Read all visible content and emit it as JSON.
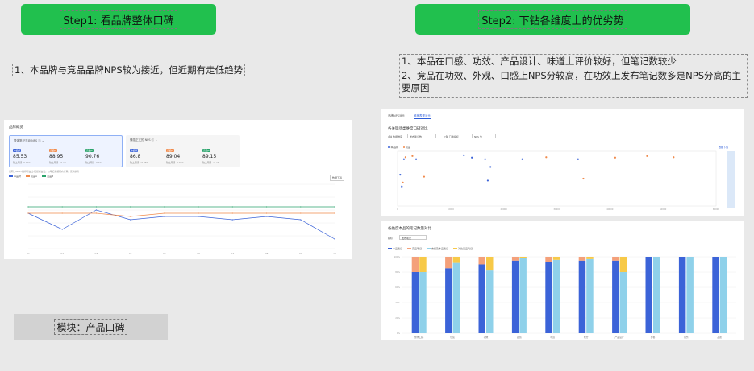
{
  "step1": {
    "label": "Step1: 看品牌整体口碑"
  },
  "step2": {
    "label": "Step2: 下钻各维度上的优劣势"
  },
  "note1": "1、本品牌与竞品品牌NPS较为接近，但近期有走低趋势",
  "note2": {
    "line1": "1、本品在口感、功效、产品设计、味道上评价较好，但笔记数较少",
    "line2": "2、竞品在功效、外观、口感上NPS分较高，在功效上发布笔记数多是NPS分高的主要原因"
  },
  "module": "模块：产品口碑",
  "left_panel": {
    "title": "品牌概览",
    "card1_title": "整体笔记互动 NPS ⓘ ⌄",
    "card2_title": "情感正文的 NPS ⓘ ⌄",
    "brands": [
      {
        "tag": "本品牌",
        "color": "#3b63d8",
        "value": "85.53",
        "sub": "较上周期 -0.01%"
      },
      {
        "tag": "竞品A",
        "color": "#f08a4b",
        "value": "88.95",
        "sub": "较上周期 +0.1%"
      },
      {
        "tag": "竞品B",
        "color": "#2aa36b",
        "value": "90.76",
        "sub": "较上周期 -0.1%"
      },
      {
        "tag": "本品牌",
        "color": "#3b63d8",
        "value": "86.8",
        "sub": "较上周期 +0.05%"
      },
      {
        "tag": "竞品A",
        "color": "#f08a4b",
        "value": "89.04",
        "sub": "较上周期 -0.01%"
      },
      {
        "tag": "竞品B",
        "color": "#2aa36b",
        "value": "89.15",
        "sub": "较上周期 +0.1%"
      }
    ],
    "desc": "说明：NPS=推荐者占比-贬损者占比，以笔记情感倾向计算，仅供参考",
    "legend": [
      "本品牌",
      "竞品A",
      "竞品B"
    ],
    "export_btn": "数据下载"
  },
  "right_top": {
    "tabs": [
      "品牌NPS对比",
      "维度表现对比"
    ],
    "sub_title": "各关键品类维度口碑对比",
    "filters": [
      "X轴 数据维度",
      "发布笔记数",
      "Y轴 口碑指标",
      "NPS 分"
    ],
    "legend": [
      "本品牌",
      "竞品"
    ],
    "export": "数据下载"
  },
  "right_bot": {
    "title": "各维度本品的笔记数量对比",
    "filter_label": "指标",
    "filter_value": "发布笔记",
    "legend": [
      "本品笔记",
      "竞品笔记",
      "未提及本品笔记",
      "对比竞品笔记"
    ]
  },
  "chart_data": [
    {
      "type": "line",
      "title": "",
      "x": [
        "01",
        "02",
        "03",
        "04",
        "05",
        "06",
        "07",
        "08",
        "09",
        "10"
      ],
      "series": [
        {
          "name": "本品牌",
          "color": "#3b63d8",
          "values": [
            86,
            81,
            87,
            84,
            85,
            85,
            84,
            85,
            84,
            78
          ]
        },
        {
          "name": "竞品A",
          "color": "#f08a4b",
          "values": [
            86,
            86,
            86,
            85,
            86,
            86,
            86,
            86,
            86,
            86
          ]
        },
        {
          "name": "竞品B",
          "color": "#2aa36b",
          "values": [
            88,
            88,
            88,
            88,
            88,
            88,
            88,
            88,
            88,
            88
          ]
        }
      ],
      "ylim": [
        75,
        95
      ]
    },
    {
      "type": "scatter",
      "xlim": [
        0,
        60000
      ],
      "ylim": [
        -40,
        100
      ],
      "series": [
        {
          "name": "本品牌",
          "color": "#3b63d8",
          "points": [
            [
              1200,
              80
            ],
            [
              3500,
              80
            ],
            [
              12500,
              90
            ],
            [
              14000,
              84
            ],
            [
              16500,
              80
            ],
            [
              17500,
              60
            ],
            [
              23500,
              80
            ],
            [
              17000,
              25
            ],
            [
              34000,
              80
            ],
            [
              500,
              40
            ],
            [
              800,
              10
            ]
          ]
        },
        {
          "name": "竞品",
          "color": "#f08a4b",
          "points": [
            [
              1500,
              85
            ],
            [
              2800,
              88
            ],
            [
              5000,
              35
            ],
            [
              28000,
              85
            ],
            [
              41000,
              84
            ],
            [
              47000,
              88
            ],
            [
              52000,
              85
            ],
            [
              35000,
              30
            ],
            [
              1000,
              20
            ]
          ]
        }
      ]
    },
    {
      "type": "bar",
      "categories": [
        "整体口感",
        "包装",
        "功效",
        "颜值",
        "味道",
        "成分",
        "产品设计",
        "价格",
        "服务",
        "品质"
      ],
      "series": [
        {
          "name": "本品笔记",
          "color": "#3b63d8",
          "values": [
            80,
            85,
            90,
            95,
            93,
            95,
            95,
            100,
            100,
            100
          ]
        },
        {
          "name": "竞品笔记",
          "color": "#f4a07a",
          "values": [
            20,
            15,
            10,
            5,
            7,
            5,
            5,
            0,
            0,
            0
          ]
        },
        {
          "name": "未提及本品笔记",
          "color": "#8fd1ea",
          "values": [
            80,
            92,
            82,
            98,
            96,
            97,
            80,
            100,
            100,
            100
          ]
        },
        {
          "name": "对比竞品笔记",
          "color": "#f7c948",
          "values": [
            20,
            8,
            18,
            2,
            4,
            3,
            20,
            0,
            0,
            0
          ]
        }
      ]
    }
  ]
}
